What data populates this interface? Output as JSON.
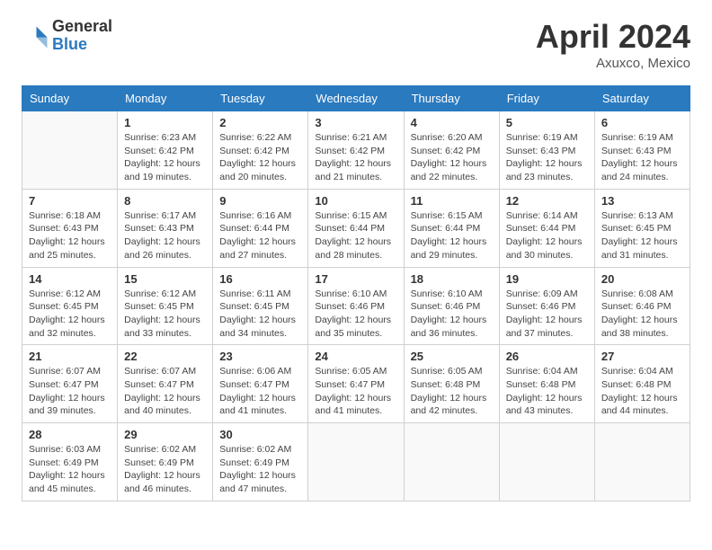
{
  "header": {
    "logo_general": "General",
    "logo_blue": "Blue",
    "title": "April 2024",
    "location": "Axuxco, Mexico"
  },
  "calendar": {
    "weekdays": [
      "Sunday",
      "Monday",
      "Tuesday",
      "Wednesday",
      "Thursday",
      "Friday",
      "Saturday"
    ],
    "weeks": [
      [
        {
          "day": null
        },
        {
          "day": "1",
          "sunrise": "6:23 AM",
          "sunset": "6:42 PM",
          "daylight": "12 hours and 19 minutes."
        },
        {
          "day": "2",
          "sunrise": "6:22 AM",
          "sunset": "6:42 PM",
          "daylight": "12 hours and 20 minutes."
        },
        {
          "day": "3",
          "sunrise": "6:21 AM",
          "sunset": "6:42 PM",
          "daylight": "12 hours and 21 minutes."
        },
        {
          "day": "4",
          "sunrise": "6:20 AM",
          "sunset": "6:42 PM",
          "daylight": "12 hours and 22 minutes."
        },
        {
          "day": "5",
          "sunrise": "6:19 AM",
          "sunset": "6:43 PM",
          "daylight": "12 hours and 23 minutes."
        },
        {
          "day": "6",
          "sunrise": "6:19 AM",
          "sunset": "6:43 PM",
          "daylight": "12 hours and 24 minutes."
        }
      ],
      [
        {
          "day": "7",
          "sunrise": "6:18 AM",
          "sunset": "6:43 PM",
          "daylight": "12 hours and 25 minutes."
        },
        {
          "day": "8",
          "sunrise": "6:17 AM",
          "sunset": "6:43 PM",
          "daylight": "12 hours and 26 minutes."
        },
        {
          "day": "9",
          "sunrise": "6:16 AM",
          "sunset": "6:44 PM",
          "daylight": "12 hours and 27 minutes."
        },
        {
          "day": "10",
          "sunrise": "6:15 AM",
          "sunset": "6:44 PM",
          "daylight": "12 hours and 28 minutes."
        },
        {
          "day": "11",
          "sunrise": "6:15 AM",
          "sunset": "6:44 PM",
          "daylight": "12 hours and 29 minutes."
        },
        {
          "day": "12",
          "sunrise": "6:14 AM",
          "sunset": "6:44 PM",
          "daylight": "12 hours and 30 minutes."
        },
        {
          "day": "13",
          "sunrise": "6:13 AM",
          "sunset": "6:45 PM",
          "daylight": "12 hours and 31 minutes."
        }
      ],
      [
        {
          "day": "14",
          "sunrise": "6:12 AM",
          "sunset": "6:45 PM",
          "daylight": "12 hours and 32 minutes."
        },
        {
          "day": "15",
          "sunrise": "6:12 AM",
          "sunset": "6:45 PM",
          "daylight": "12 hours and 33 minutes."
        },
        {
          "day": "16",
          "sunrise": "6:11 AM",
          "sunset": "6:45 PM",
          "daylight": "12 hours and 34 minutes."
        },
        {
          "day": "17",
          "sunrise": "6:10 AM",
          "sunset": "6:46 PM",
          "daylight": "12 hours and 35 minutes."
        },
        {
          "day": "18",
          "sunrise": "6:10 AM",
          "sunset": "6:46 PM",
          "daylight": "12 hours and 36 minutes."
        },
        {
          "day": "19",
          "sunrise": "6:09 AM",
          "sunset": "6:46 PM",
          "daylight": "12 hours and 37 minutes."
        },
        {
          "day": "20",
          "sunrise": "6:08 AM",
          "sunset": "6:46 PM",
          "daylight": "12 hours and 38 minutes."
        }
      ],
      [
        {
          "day": "21",
          "sunrise": "6:07 AM",
          "sunset": "6:47 PM",
          "daylight": "12 hours and 39 minutes."
        },
        {
          "day": "22",
          "sunrise": "6:07 AM",
          "sunset": "6:47 PM",
          "daylight": "12 hours and 40 minutes."
        },
        {
          "day": "23",
          "sunrise": "6:06 AM",
          "sunset": "6:47 PM",
          "daylight": "12 hours and 41 minutes."
        },
        {
          "day": "24",
          "sunrise": "6:05 AM",
          "sunset": "6:47 PM",
          "daylight": "12 hours and 41 minutes."
        },
        {
          "day": "25",
          "sunrise": "6:05 AM",
          "sunset": "6:48 PM",
          "daylight": "12 hours and 42 minutes."
        },
        {
          "day": "26",
          "sunrise": "6:04 AM",
          "sunset": "6:48 PM",
          "daylight": "12 hours and 43 minutes."
        },
        {
          "day": "27",
          "sunrise": "6:04 AM",
          "sunset": "6:48 PM",
          "daylight": "12 hours and 44 minutes."
        }
      ],
      [
        {
          "day": "28",
          "sunrise": "6:03 AM",
          "sunset": "6:49 PM",
          "daylight": "12 hours and 45 minutes."
        },
        {
          "day": "29",
          "sunrise": "6:02 AM",
          "sunset": "6:49 PM",
          "daylight": "12 hours and 46 minutes."
        },
        {
          "day": "30",
          "sunrise": "6:02 AM",
          "sunset": "6:49 PM",
          "daylight": "12 hours and 47 minutes."
        },
        {
          "day": null
        },
        {
          "day": null
        },
        {
          "day": null
        },
        {
          "day": null
        }
      ]
    ]
  }
}
